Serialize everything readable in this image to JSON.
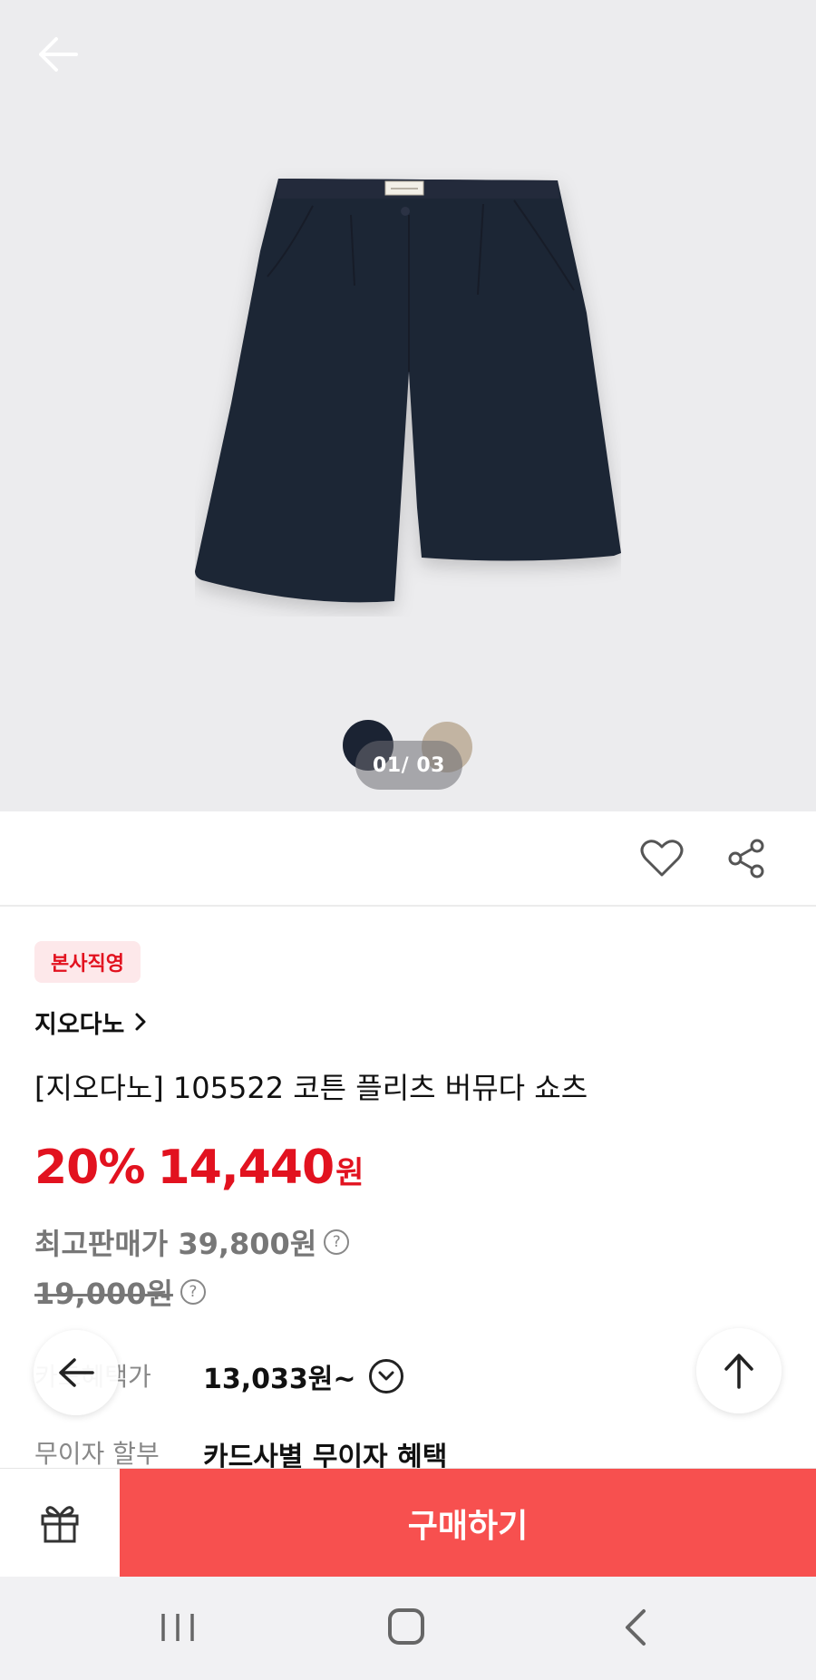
{
  "gallery": {
    "counter": "01/ 03",
    "swatches": [
      {
        "name": "navy",
        "color": "#1b2333"
      },
      {
        "name": "beige",
        "color": "#c2b4a2"
      }
    ]
  },
  "product": {
    "badge": "본사직영",
    "brand": "지오다노",
    "title": "[지오다노] 105522 코튼 플리츠 버뮤다 쇼츠",
    "discount": "20%",
    "price": "14,440",
    "price_unit": "원",
    "max_price": "최고판매가 39,800원",
    "original_price": "19,000원",
    "card_benefit_label": "카드혜택가",
    "card_benefit_value": "13,033원~",
    "installment_label": "무이자 할부",
    "installment_value": "카드사별 무이자 혜택"
  },
  "purchase": {
    "buy_label": "구매하기"
  },
  "icons": {
    "back": "arrow-left-icon",
    "favorite": "heart-icon",
    "share": "share-icon",
    "gift": "gift-icon",
    "scroll_top": "arrow-up-icon"
  },
  "colors": {
    "accent": "#e2121f",
    "buy_button": "#f7504f",
    "badge_bg": "#fde8ea"
  }
}
